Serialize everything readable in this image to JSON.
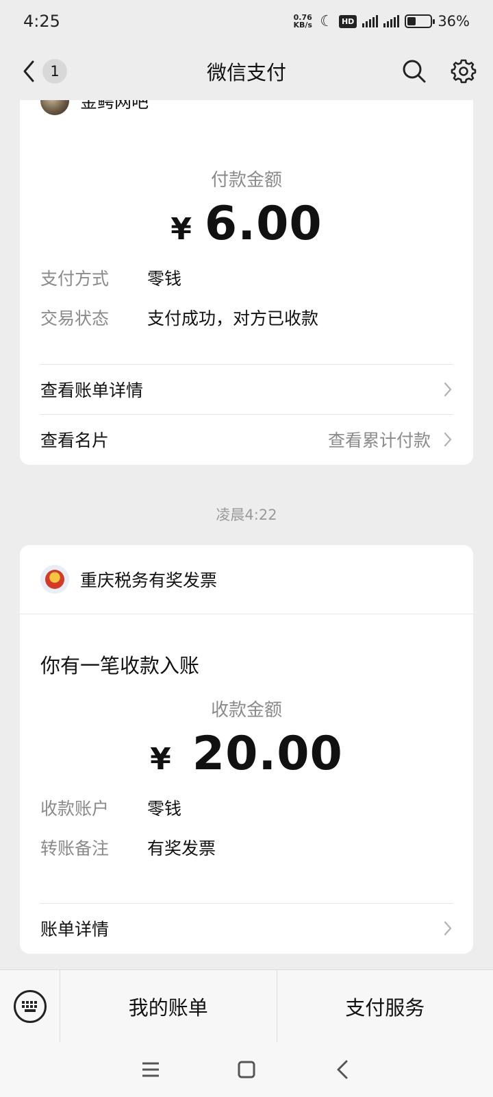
{
  "status": {
    "time": "4:25",
    "net_speed": "0.76 KB/s",
    "battery": "36%",
    "battery_level": 0.36
  },
  "nav": {
    "title": "微信支付",
    "unread_count": "1"
  },
  "payment_card": {
    "merchant_name": "金鳄网吧",
    "amount_label": "付款金额",
    "currency": "¥",
    "amount": "6.00",
    "rows": [
      {
        "key": "支付方式",
        "value": "零钱"
      },
      {
        "key": "交易状态",
        "value": "支付成功，对方已收款"
      }
    ],
    "links": [
      {
        "label": "查看账单详情",
        "right": ""
      },
      {
        "label": "查看名片",
        "right": "查看累计付款"
      }
    ]
  },
  "timestamp": "凌晨4:22",
  "receipt_card": {
    "merchant_name": "重庆税务有奖发票",
    "headline": "你有一笔收款入账",
    "amount_label": "收款金额",
    "currency": "¥",
    "amount": "20.00",
    "rows": [
      {
        "key": "收款账户",
        "value": "零钱"
      },
      {
        "key": "转账备注",
        "value": "有奖发票"
      }
    ],
    "link": "账单详情"
  },
  "bottom_bar": {
    "tabs": [
      "我的账单",
      "支付服务"
    ]
  }
}
